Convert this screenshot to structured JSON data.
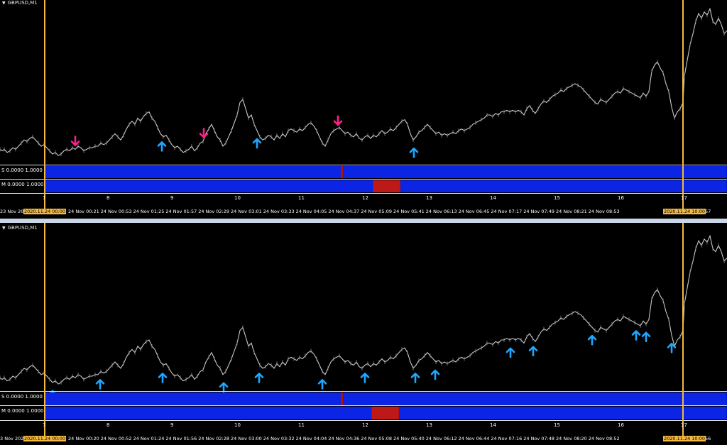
{
  "colors": {
    "background": "#000000",
    "price_line": "#c8c8c8",
    "up_arrow": "#1ea7ff",
    "down_arrow": "#ff1f8c",
    "vline": "#f4b942",
    "strip_blue": "#0018d8",
    "strip_red": "#b01010",
    "panel_border": "#e0e0e0"
  },
  "top": {
    "symbol_label": "GBPUSD,M1",
    "s_label": "S 0.0000 1.0000",
    "m_label": "M 0.0000 1.0000",
    "hours": [
      "7",
      "8",
      "9",
      "10",
      "11",
      "12",
      "13",
      "14",
      "15",
      "16",
      "17"
    ],
    "time_first": "23 Nov 202",
    "time_start_hl": "2020.11.24 00:00",
    "times": [
      "24 Nov 00:21",
      "24 Nov 00:53",
      "24 Nov 01:25",
      "24 Nov 01:57",
      "24 Nov 02:29",
      "24 Nov 03:01",
      "24 Nov 03:33",
      "24 Nov 04:05",
      "24 Nov 04:37",
      "24 Nov 05:09",
      "24 Nov 05:41",
      "24 Nov 06:13",
      "24 Nov 06:45",
      "24 Nov 07:17",
      "24 Nov 07:49",
      "24 Nov 08:21",
      "24 Nov 08:53"
    ],
    "time_end_hl": "2020.11.24 10:00",
    "time_last": "57"
  },
  "bottom": {
    "symbol_label": "GBPUSD,M1",
    "s_label": "S 0.0000 1.0000",
    "m_label": "M 0.0000 1.0000",
    "hours": [
      "7",
      "8",
      "9",
      "10",
      "11",
      "12",
      "13",
      "14",
      "15",
      "16",
      "17"
    ],
    "time_first": "3 Nov 202",
    "time_start_hl": "2020.11.24 00:00",
    "times": [
      "24 Nov 00:20",
      "24 Nov 00:52",
      "24 Nov 01:24",
      "24 Nov 01:56",
      "24 Nov 02:28",
      "24 Nov 03:00",
      "24 Nov 03:32",
      "24 Nov 04:04",
      "24 Nov 04:36",
      "24 Nov 05:08",
      "24 Nov 05:40",
      "24 Nov 06:12",
      "24 Nov 06:44",
      "24 Nov 07:16",
      "24 Nov 07:48",
      "24 Nov 08:20",
      "24 Nov 08:52"
    ],
    "time_end_hl": "2020.11.24 10:00",
    "time_last": "56"
  },
  "price_series": [
    [
      0,
      0.92
    ],
    [
      3,
      0.93
    ],
    [
      6,
      0.92
    ],
    [
      10,
      0.94
    ],
    [
      14,
      0.93
    ],
    [
      18,
      0.91
    ],
    [
      22,
      0.92
    ],
    [
      26,
      0.9
    ],
    [
      30,
      0.88
    ],
    [
      34,
      0.86
    ],
    [
      38,
      0.87
    ],
    [
      42,
      0.85
    ],
    [
      46,
      0.84
    ],
    [
      50,
      0.86
    ],
    [
      54,
      0.88
    ],
    [
      58,
      0.9
    ],
    [
      62,
      0.89
    ],
    [
      66,
      0.91
    ],
    [
      70,
      0.93
    ],
    [
      74,
      0.95
    ],
    [
      78,
      0.94
    ],
    [
      82,
      0.96
    ],
    [
      86,
      0.95
    ],
    [
      90,
      0.93
    ],
    [
      94,
      0.92
    ],
    [
      98,
      0.93
    ],
    [
      102,
      0.91
    ],
    [
      106,
      0.92
    ],
    [
      110,
      0.9
    ],
    [
      114,
      0.91
    ],
    [
      118,
      0.93
    ],
    [
      122,
      0.92
    ],
    [
      126,
      0.91
    ],
    [
      130,
      0.91
    ],
    [
      134,
      0.9
    ],
    [
      138,
      0.9
    ],
    [
      142,
      0.88
    ],
    [
      146,
      0.89
    ],
    [
      150,
      0.88
    ],
    [
      154,
      0.86
    ],
    [
      158,
      0.84
    ],
    [
      162,
      0.82
    ],
    [
      166,
      0.84
    ],
    [
      170,
      0.86
    ],
    [
      174,
      0.83
    ],
    [
      178,
      0.79
    ],
    [
      182,
      0.76
    ],
    [
      186,
      0.74
    ],
    [
      190,
      0.76
    ],
    [
      194,
      0.72
    ],
    [
      198,
      0.74
    ],
    [
      202,
      0.71
    ],
    [
      206,
      0.69
    ],
    [
      210,
      0.68
    ],
    [
      214,
      0.72
    ],
    [
      218,
      0.74
    ],
    [
      222,
      0.78
    ],
    [
      226,
      0.82
    ],
    [
      230,
      0.84
    ],
    [
      234,
      0.83
    ],
    [
      238,
      0.86
    ],
    [
      242,
      0.89
    ],
    [
      246,
      0.91
    ],
    [
      250,
      0.9
    ],
    [
      254,
      0.92
    ],
    [
      258,
      0.94
    ],
    [
      262,
      0.93
    ],
    [
      266,
      0.92
    ],
    [
      270,
      0.9
    ],
    [
      274,
      0.93
    ],
    [
      278,
      0.91
    ],
    [
      282,
      0.88
    ],
    [
      286,
      0.87
    ],
    [
      290,
      0.82
    ],
    [
      294,
      0.79
    ],
    [
      298,
      0.76
    ],
    [
      302,
      0.8
    ],
    [
      306,
      0.84
    ],
    [
      310,
      0.86
    ],
    [
      314,
      0.9
    ],
    [
      318,
      0.88
    ],
    [
      322,
      0.84
    ],
    [
      326,
      0.8
    ],
    [
      330,
      0.75
    ],
    [
      334,
      0.7
    ],
    [
      338,
      0.62
    ],
    [
      342,
      0.6
    ],
    [
      346,
      0.66
    ],
    [
      350,
      0.72
    ],
    [
      354,
      0.7
    ],
    [
      358,
      0.76
    ],
    [
      362,
      0.8
    ],
    [
      366,
      0.84
    ],
    [
      370,
      0.86
    ],
    [
      374,
      0.85
    ],
    [
      378,
      0.83
    ],
    [
      382,
      0.84
    ],
    [
      386,
      0.86
    ],
    [
      390,
      0.83
    ],
    [
      394,
      0.85
    ],
    [
      398,
      0.82
    ],
    [
      402,
      0.84
    ],
    [
      406,
      0.8
    ],
    [
      410,
      0.79
    ],
    [
      414,
      0.8
    ],
    [
      418,
      0.81
    ],
    [
      422,
      0.79
    ],
    [
      426,
      0.8
    ],
    [
      430,
      0.78
    ],
    [
      434,
      0.76
    ],
    [
      438,
      0.75
    ],
    [
      442,
      0.77
    ],
    [
      446,
      0.8
    ],
    [
      450,
      0.84
    ],
    [
      454,
      0.88
    ],
    [
      458,
      0.9
    ],
    [
      462,
      0.86
    ],
    [
      466,
      0.82
    ],
    [
      470,
      0.8
    ],
    [
      474,
      0.79
    ],
    [
      478,
      0.78
    ],
    [
      482,
      0.8
    ],
    [
      486,
      0.82
    ],
    [
      490,
      0.81
    ],
    [
      494,
      0.83
    ],
    [
      498,
      0.84
    ],
    [
      502,
      0.82
    ],
    [
      506,
      0.85
    ],
    [
      510,
      0.86
    ],
    [
      514,
      0.84
    ],
    [
      518,
      0.83
    ],
    [
      522,
      0.85
    ],
    [
      526,
      0.83
    ],
    [
      530,
      0.84
    ],
    [
      534,
      0.82
    ],
    [
      538,
      0.8
    ],
    [
      542,
      0.82
    ],
    [
      546,
      0.81
    ],
    [
      550,
      0.79
    ],
    [
      554,
      0.8
    ],
    [
      558,
      0.78
    ],
    [
      562,
      0.76
    ],
    [
      566,
      0.74
    ],
    [
      570,
      0.73
    ],
    [
      574,
      0.76
    ],
    [
      578,
      0.82
    ],
    [
      582,
      0.86
    ],
    [
      586,
      0.84
    ],
    [
      590,
      0.81
    ],
    [
      594,
      0.8
    ],
    [
      598,
      0.78
    ],
    [
      602,
      0.76
    ],
    [
      606,
      0.78
    ],
    [
      610,
      0.8
    ],
    [
      614,
      0.82
    ],
    [
      618,
      0.81
    ],
    [
      622,
      0.83
    ],
    [
      626,
      0.82
    ],
    [
      630,
      0.83
    ],
    [
      634,
      0.82
    ],
    [
      638,
      0.81
    ],
    [
      642,
      0.82
    ],
    [
      646,
      0.8
    ],
    [
      650,
      0.79
    ],
    [
      654,
      0.8
    ],
    [
      658,
      0.79
    ],
    [
      662,
      0.78
    ],
    [
      666,
      0.76
    ],
    [
      670,
      0.75
    ],
    [
      674,
      0.74
    ],
    [
      678,
      0.73
    ],
    [
      682,
      0.72
    ],
    [
      686,
      0.7
    ],
    [
      690,
      0.7
    ],
    [
      694,
      0.71
    ],
    [
      698,
      0.69
    ],
    [
      702,
      0.7
    ],
    [
      706,
      0.68
    ],
    [
      710,
      0.68
    ],
    [
      714,
      0.67
    ],
    [
      718,
      0.68
    ],
    [
      722,
      0.67
    ],
    [
      726,
      0.68
    ],
    [
      730,
      0.67
    ],
    [
      734,
      0.68
    ],
    [
      738,
      0.7
    ],
    [
      742,
      0.66
    ],
    [
      746,
      0.64
    ],
    [
      750,
      0.67
    ],
    [
      754,
      0.69
    ],
    [
      758,
      0.66
    ],
    [
      762,
      0.63
    ],
    [
      766,
      0.61
    ],
    [
      770,
      0.62
    ],
    [
      774,
      0.6
    ],
    [
      778,
      0.58
    ],
    [
      782,
      0.57
    ],
    [
      786,
      0.56
    ],
    [
      790,
      0.54
    ],
    [
      794,
      0.55
    ],
    [
      798,
      0.53
    ],
    [
      802,
      0.52
    ],
    [
      806,
      0.51
    ],
    [
      810,
      0.5
    ],
    [
      814,
      0.51
    ],
    [
      818,
      0.52
    ],
    [
      822,
      0.54
    ],
    [
      826,
      0.56
    ],
    [
      830,
      0.58
    ],
    [
      834,
      0.6
    ],
    [
      838,
      0.62
    ],
    [
      842,
      0.63
    ],
    [
      846,
      0.6
    ],
    [
      850,
      0.61
    ],
    [
      854,
      0.62
    ],
    [
      858,
      0.6
    ],
    [
      862,
      0.58
    ],
    [
      866,
      0.56
    ],
    [
      870,
      0.55
    ],
    [
      874,
      0.56
    ],
    [
      878,
      0.53
    ],
    [
      882,
      0.54
    ],
    [
      886,
      0.55
    ],
    [
      890,
      0.56
    ],
    [
      894,
      0.57
    ],
    [
      898,
      0.58
    ],
    [
      902,
      0.59
    ],
    [
      906,
      0.56
    ],
    [
      910,
      0.58
    ],
    [
      914,
      0.55
    ],
    [
      918,
      0.42
    ],
    [
      922,
      0.38
    ],
    [
      926,
      0.36
    ],
    [
      930,
      0.4
    ],
    [
      934,
      0.43
    ],
    [
      938,
      0.5
    ],
    [
      942,
      0.55
    ],
    [
      946,
      0.65
    ],
    [
      950,
      0.72
    ],
    [
      954,
      0.68
    ],
    [
      958,
      0.66
    ],
    [
      962,
      0.62
    ],
    [
      964,
      0.45
    ],
    [
      968,
      0.35
    ],
    [
      972,
      0.25
    ],
    [
      976,
      0.18
    ],
    [
      980,
      0.1
    ],
    [
      984,
      0.05
    ],
    [
      988,
      0.08
    ],
    [
      992,
      0.04
    ],
    [
      996,
      0.06
    ],
    [
      1000,
      0.02
    ],
    [
      1004,
      0.1
    ],
    [
      1008,
      0.12
    ],
    [
      1012,
      0.08
    ],
    [
      1016,
      0.12
    ],
    [
      1020,
      0.18
    ],
    [
      1024,
      0.16
    ]
  ],
  "top_arrows": [
    {
      "t": 228,
      "dir": "up"
    },
    {
      "t": 362,
      "dir": "up"
    },
    {
      "t": 583,
      "dir": "up"
    },
    {
      "t": 106,
      "dir": "down"
    },
    {
      "t": 287,
      "dir": "down"
    },
    {
      "t": 476,
      "dir": "down"
    }
  ],
  "bottom_arrows": [
    {
      "t": 74,
      "dir": "up"
    },
    {
      "t": 141,
      "dir": "up"
    },
    {
      "t": 229,
      "dir": "up"
    },
    {
      "t": 315,
      "dir": "up"
    },
    {
      "t": 365,
      "dir": "up"
    },
    {
      "t": 454,
      "dir": "up"
    },
    {
      "t": 514,
      "dir": "up"
    },
    {
      "t": 585,
      "dir": "up"
    },
    {
      "t": 613,
      "dir": "up"
    },
    {
      "t": 719,
      "dir": "up"
    },
    {
      "t": 751,
      "dir": "up"
    },
    {
      "t": 834,
      "dir": "up"
    },
    {
      "t": 896,
      "dir": "up"
    },
    {
      "t": 910,
      "dir": "up"
    },
    {
      "t": 946,
      "dir": "up"
    }
  ]
}
